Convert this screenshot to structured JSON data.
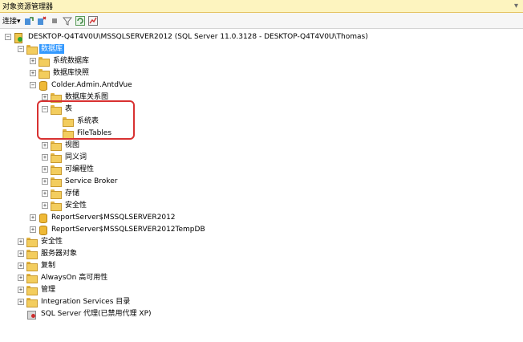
{
  "window": {
    "title": "对象资源管理器"
  },
  "toolbar": {
    "connect_label": "连接▾"
  },
  "tree": {
    "server": "DESKTOP-Q4T4V0U\\MSSQLSERVER2012 (SQL Server 11.0.3128 - DESKTOP-Q4T4V0U\\Thomas)",
    "databases": "数据库",
    "system_databases": "系统数据库",
    "db_snapshots": "数据库快照",
    "user_db": "Colder.Admin.AntdVue",
    "db_diagrams": "数据库关系图",
    "tables": "表",
    "system_tables": "系统表",
    "file_tables": "FileTables",
    "views": "视图",
    "synonyms": "同义词",
    "programmability": "可编程性",
    "service_broker": "Service Broker",
    "storage": "存储",
    "db_security": "安全性",
    "report_server": "ReportServer$MSSQLSERVER2012",
    "report_server_temp": "ReportServer$MSSQLSERVER2012TempDB",
    "security": "安全性",
    "server_objects": "服务器对象",
    "replication": "复制",
    "alwayson": "AlwaysOn 高可用性",
    "management": "管理",
    "integration_services": "Integration Services 目录",
    "sql_agent": "SQL Server 代理(已禁用代理 XP)"
  },
  "colors": {
    "selection": "#3399ff",
    "highlight_border": "#d83131",
    "title_bg": "#fdf4bf"
  }
}
